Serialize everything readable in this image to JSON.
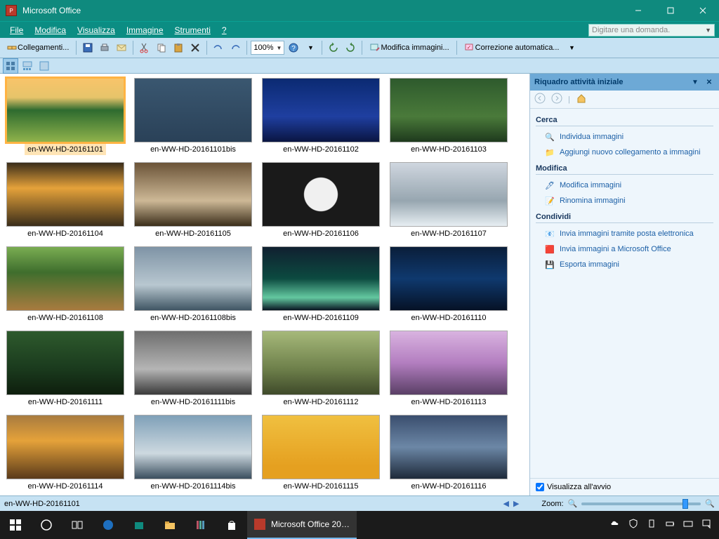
{
  "window": {
    "title": "Microsoft Office"
  },
  "menubar": {
    "items": [
      "File",
      "Modifica",
      "Visualizza",
      "Immagine",
      "Strumenti",
      "?"
    ],
    "question_placeholder": "Digitare una domanda."
  },
  "toolbar": {
    "shortcuts_label": "Collegamenti...",
    "zoom_value": "100%",
    "edit_images_label": "Modifica immagini...",
    "autocorrect_label": "Correzione automatica..."
  },
  "taskpane": {
    "title": "Riquadro attività iniziale",
    "sections": {
      "search": {
        "title": "Cerca",
        "links": [
          "Individua immagini",
          "Aggiungi nuovo collegamento a immagini"
        ]
      },
      "edit": {
        "title": "Modifica",
        "links": [
          "Modifica immagini",
          "Rinomina immagini"
        ]
      },
      "share": {
        "title": "Condividi",
        "links": [
          "Invia immagini tramite posta elettronica",
          "Invia immagini a Microsoft Office",
          "Esporta immagini"
        ]
      }
    },
    "show_startup": "Visualizza all'avvio"
  },
  "gallery": {
    "items": [
      {
        "name": "en-WW-HD-20161101",
        "g": "g1"
      },
      {
        "name": "en-WW-HD-20161101bis",
        "g": "g2"
      },
      {
        "name": "en-WW-HD-20161102",
        "g": "g3"
      },
      {
        "name": "en-WW-HD-20161103",
        "g": "g4"
      },
      {
        "name": "en-WW-HD-20161104",
        "g": "g5"
      },
      {
        "name": "en-WW-HD-20161105",
        "g": "g6"
      },
      {
        "name": "en-WW-HD-20161106",
        "g": "g7"
      },
      {
        "name": "en-WW-HD-20161107",
        "g": "g8"
      },
      {
        "name": "en-WW-HD-20161108",
        "g": "g9"
      },
      {
        "name": "en-WW-HD-20161108bis",
        "g": "g10"
      },
      {
        "name": "en-WW-HD-20161109",
        "g": "g11"
      },
      {
        "name": "en-WW-HD-20161110",
        "g": "g12"
      },
      {
        "name": "en-WW-HD-20161111",
        "g": "g13"
      },
      {
        "name": "en-WW-HD-20161111bis",
        "g": "g14"
      },
      {
        "name": "en-WW-HD-20161112",
        "g": "g15"
      },
      {
        "name": "en-WW-HD-20161113",
        "g": "g16"
      },
      {
        "name": "en-WW-HD-20161114",
        "g": "g17"
      },
      {
        "name": "en-WW-HD-20161114bis",
        "g": "g18"
      },
      {
        "name": "en-WW-HD-20161115",
        "g": "g19"
      },
      {
        "name": "en-WW-HD-20161116",
        "g": "g20"
      }
    ],
    "selected_index": 0
  },
  "statusbar": {
    "current": "en-WW-HD-20161101",
    "zoom_label": "Zoom:"
  },
  "taskbar": {
    "app_label": "Microsoft Office 20…"
  }
}
